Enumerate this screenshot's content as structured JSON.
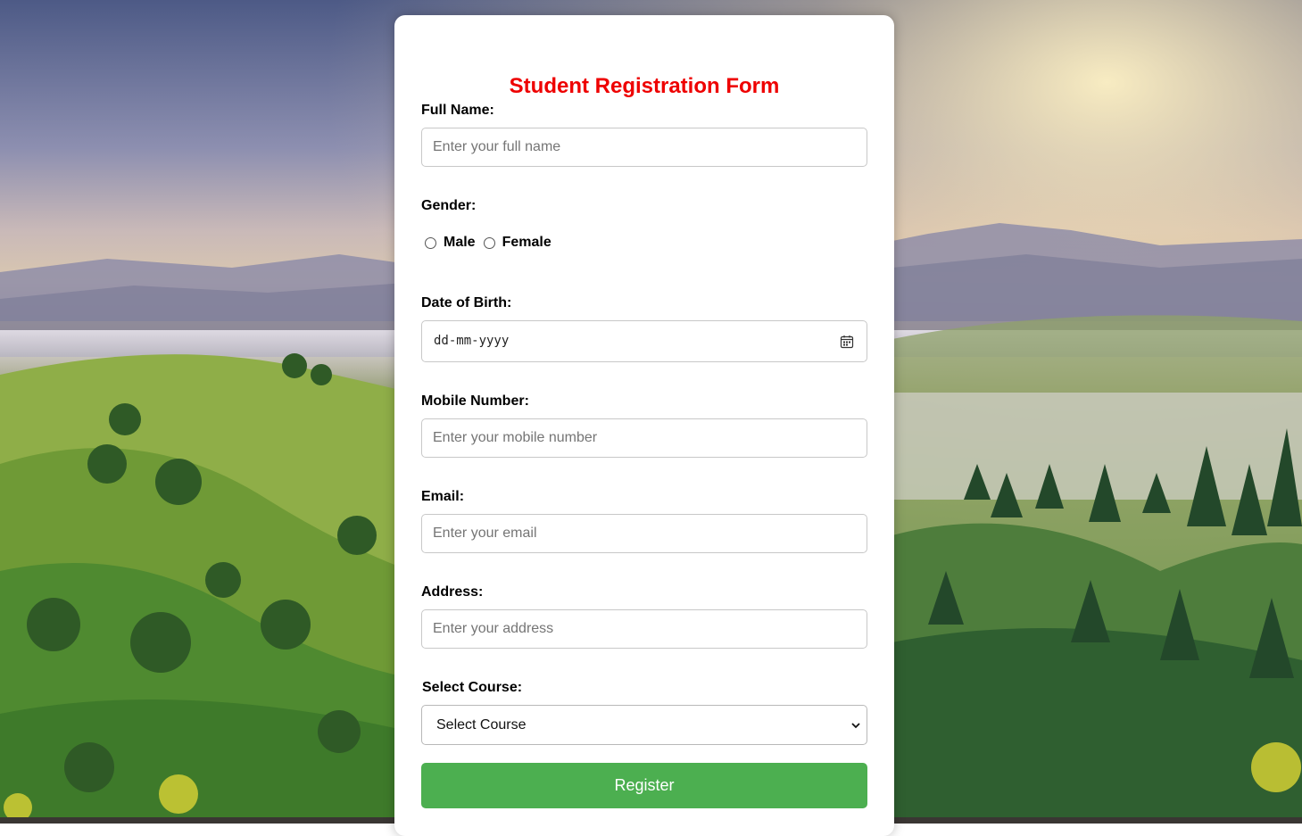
{
  "form": {
    "title": "Student Registration Form",
    "full_name_label": "Full Name:",
    "full_name_placeholder": "Enter your full name",
    "gender_label": "Gender:",
    "gender_options": [
      "Male",
      "Female"
    ],
    "dob_label": "Date of Birth:",
    "dob_placeholder": "dd-mm-yyyy",
    "mobile_label": "Mobile Number:",
    "mobile_placeholder": "Enter your mobile number",
    "email_label": "Email:",
    "email_placeholder": "Enter your email",
    "address_label": "Address:",
    "address_placeholder": "Enter your address",
    "course_label": "Select Course:",
    "course_selected": "Select Course",
    "register_label": "Register"
  },
  "colors": {
    "title": "#ee0000",
    "register_button": "#4caf50"
  },
  "icons": {
    "date_picker": "calendar-icon",
    "select_arrow": "chevron-down-icon"
  }
}
